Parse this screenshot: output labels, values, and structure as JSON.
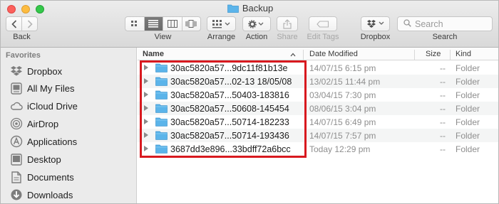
{
  "window": {
    "title": "Backup"
  },
  "toolbar": {
    "back_label": "Back",
    "view_label": "View",
    "arrange_label": "Arrange",
    "action_label": "Action",
    "share_label": "Share",
    "edit_tags_label": "Edit Tags",
    "dropbox_label": "Dropbox",
    "search_label": "Search",
    "search_placeholder": "Search"
  },
  "sidebar": {
    "header": "Favorites",
    "items": [
      {
        "label": "Dropbox",
        "icon": "dropbox-icon"
      },
      {
        "label": "All My Files",
        "icon": "all-files-icon"
      },
      {
        "label": "iCloud Drive",
        "icon": "cloud-icon"
      },
      {
        "label": "AirDrop",
        "icon": "airdrop-icon"
      },
      {
        "label": "Applications",
        "icon": "applications-icon"
      },
      {
        "label": "Desktop",
        "icon": "desktop-icon"
      },
      {
        "label": "Documents",
        "icon": "documents-icon"
      },
      {
        "label": "Downloads",
        "icon": "downloads-icon"
      }
    ]
  },
  "list": {
    "columns": {
      "name": "Name",
      "date": "Date Modified",
      "size": "Size",
      "kind": "Kind"
    },
    "rows": [
      {
        "name": "30ac5820a57...9dc11f81b13e",
        "date": "14/07/15 6:15 pm",
        "size": "--",
        "kind": "Folder"
      },
      {
        "name": "30ac5820a57...02-13 18/05/08",
        "date": "13/02/15 11:44 pm",
        "size": "--",
        "kind": "Folder"
      },
      {
        "name": "30ac5820a57...50403-183816",
        "date": "03/04/15 7:30 pm",
        "size": "--",
        "kind": "Folder"
      },
      {
        "name": "30ac5820a57...50608-145454",
        "date": "08/06/15 3:04 pm",
        "size": "--",
        "kind": "Folder"
      },
      {
        "name": "30ac5820a57...50714-182233",
        "date": "14/07/15 6:49 pm",
        "size": "--",
        "kind": "Folder"
      },
      {
        "name": "30ac5820a57...50714-193436",
        "date": "14/07/15 7:57 pm",
        "size": "--",
        "kind": "Folder"
      },
      {
        "name": "3687dd3e896...33bdff72a6bcc",
        "date": "Today 12:29 pm",
        "size": "--",
        "kind": "Folder"
      }
    ]
  },
  "colors": {
    "highlight": "#d8191f",
    "folder": "#5bb4ea",
    "selected_segment": "#6f6f6f"
  }
}
